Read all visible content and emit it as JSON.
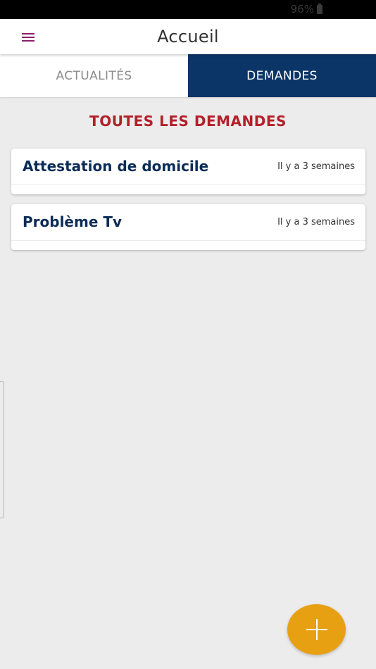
{
  "status_bar": {
    "battery": "96%"
  },
  "app_bar": {
    "title": "Accueil"
  },
  "tabs": [
    {
      "label": "ACTUALITÉS",
      "active": false
    },
    {
      "label": "DEMANDES",
      "active": true
    }
  ],
  "section": {
    "title": "TOUTES LES DEMANDES"
  },
  "requests": [
    {
      "title": "Attestation de domicile",
      "time": "Il y a 3 semaines"
    },
    {
      "title": "Problème Tv",
      "time": "Il y a 3 semaines"
    }
  ],
  "colors": {
    "accent_red": "#b3202a",
    "tab_active_bg": "#0b3567",
    "fab": "#e8a013",
    "menu_icon": "#8a1f6b"
  },
  "icons": {
    "menu": "hamburger-menu-icon",
    "battery": "battery-icon",
    "add": "plus-icon"
  }
}
